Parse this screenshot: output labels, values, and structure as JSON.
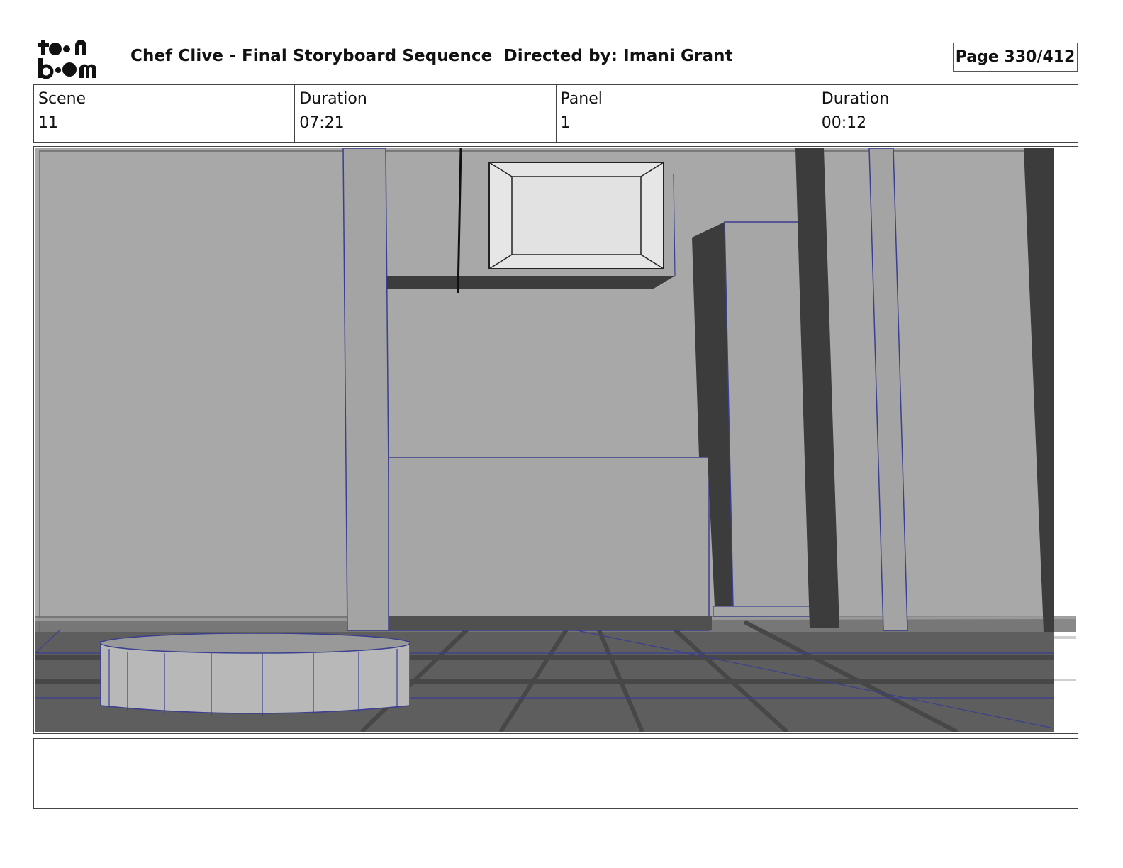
{
  "logo": {
    "text_line1": "toon",
    "text_line2": "boom"
  },
  "header": {
    "title": "Chef Clive - Final Storyboard Sequence  Directed by: Imani Grant",
    "page": "Page 330/412"
  },
  "info": {
    "scene_label": "Scene",
    "scene_value": "11",
    "scene_duration_label": "Duration",
    "scene_duration_value": "07:21",
    "panel_label": "Panel",
    "panel_value": "1",
    "panel_duration_label": "Duration",
    "panel_duration_value": "00:12"
  },
  "colors": {
    "wall": "#a8a8a8",
    "floor": "#5e5e5e",
    "shadow": "#3c3c3c",
    "wireframe": "#3a3f8f",
    "frame_light": "#e6e6e6"
  },
  "notes": {
    "text": ""
  }
}
